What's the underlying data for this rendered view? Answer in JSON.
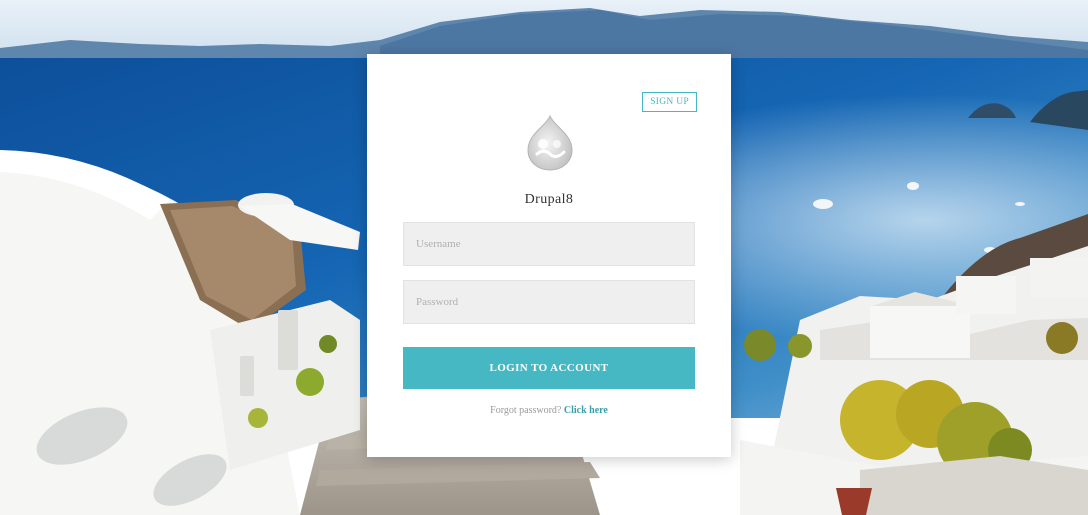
{
  "background": {
    "scene": "santorini-coastline-photo"
  },
  "card": {
    "signup_label": "SIGN UP",
    "logo_icon": "drupal-drop-icon",
    "brand_name": "Drupal8",
    "username_placeholder": "Username",
    "password_placeholder": "Password",
    "login_label": "LOGIN TO ACCOUNT",
    "forgot_text": "Forgot password?",
    "forgot_link": "Click here"
  },
  "colors": {
    "accent": "#46b8c4",
    "field_bg": "#efefef",
    "card_bg": "#ffffff"
  }
}
